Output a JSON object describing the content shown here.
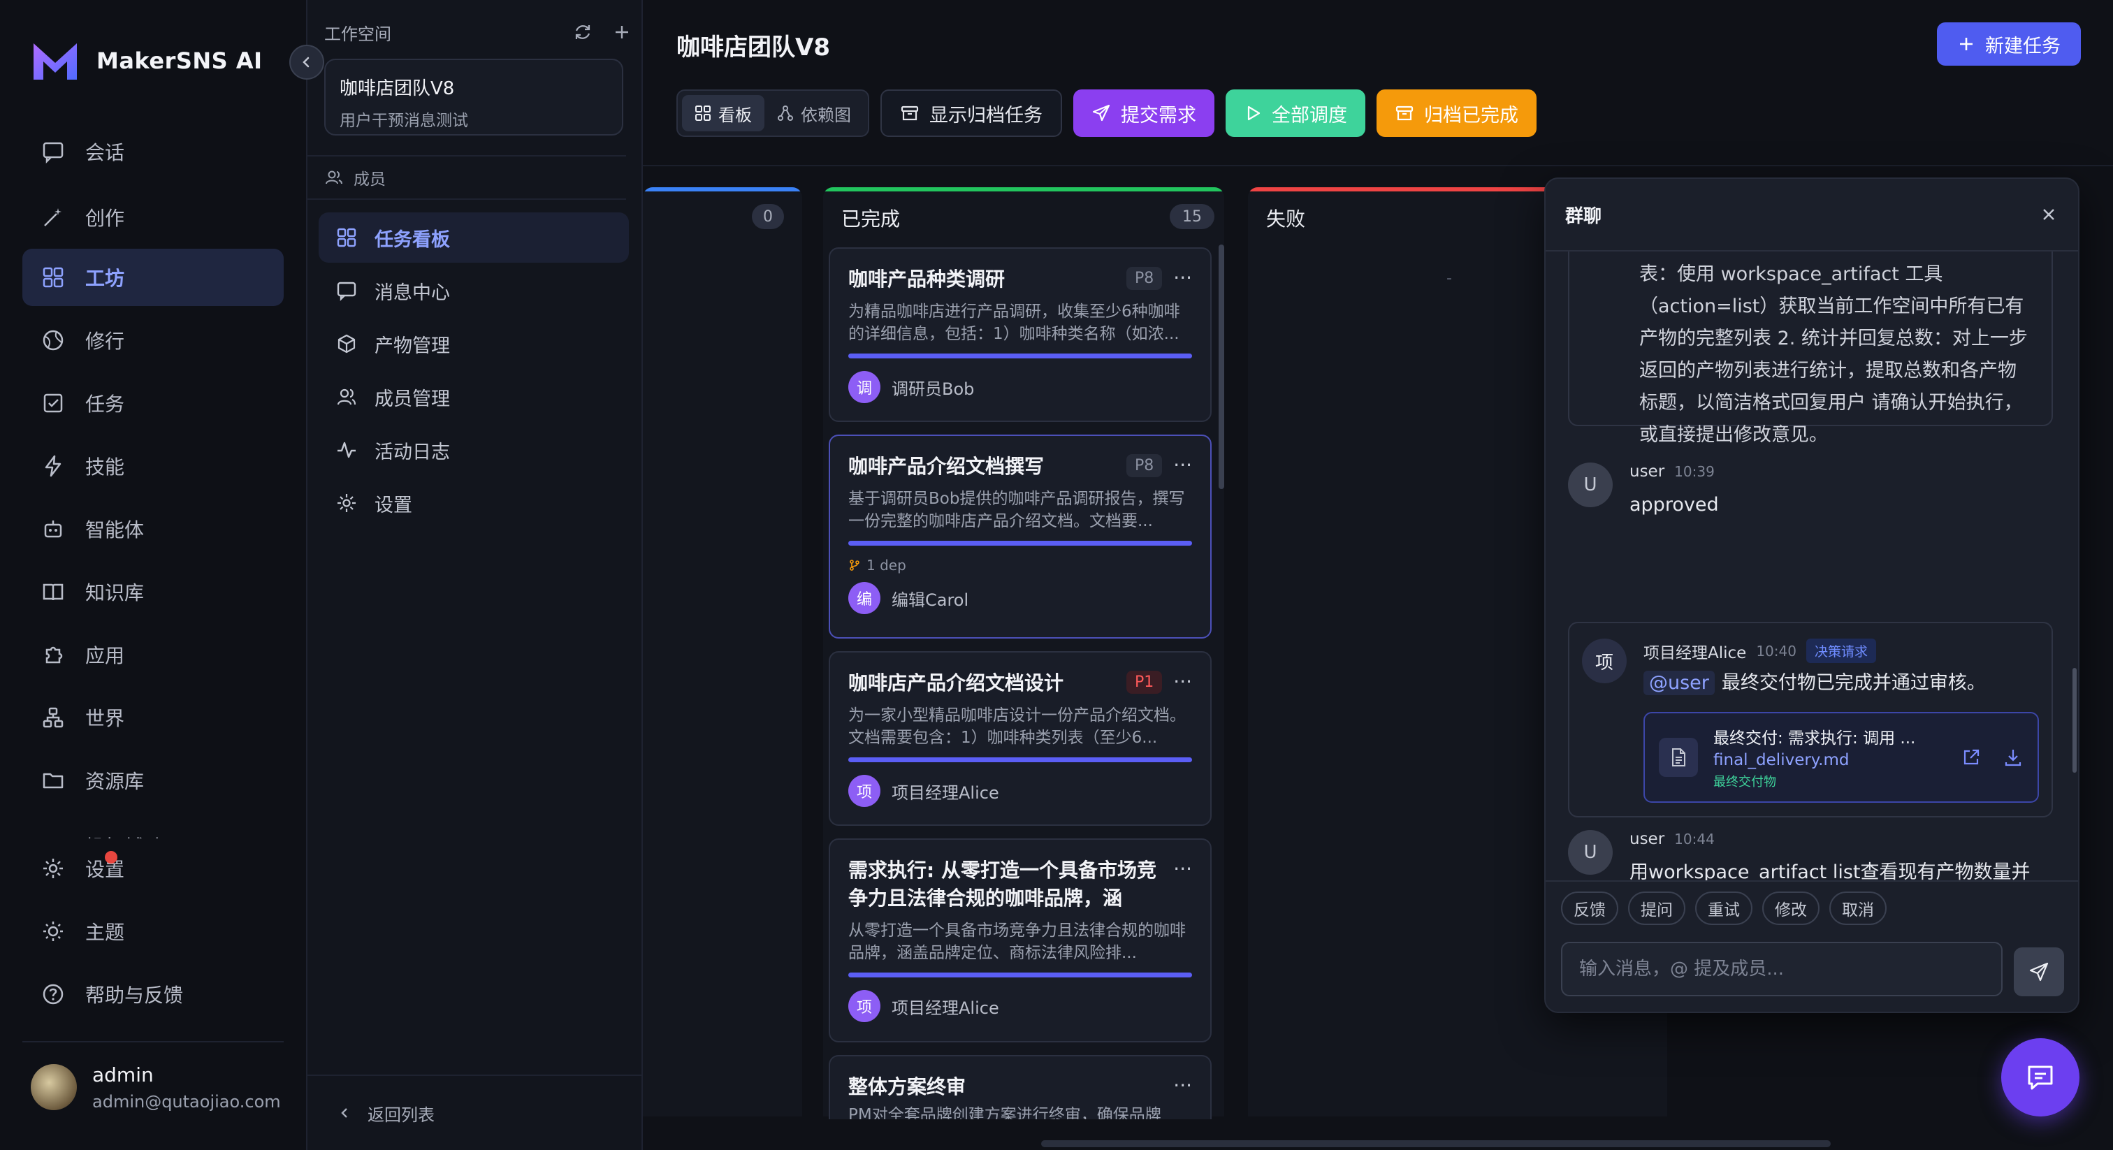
{
  "app": {
    "name": "MakerSNS AI",
    "brand_color": "#6c5cf5"
  },
  "nav": {
    "items": [
      {
        "label": "会话",
        "icon": "chat-bubble-icon"
      },
      {
        "label": "创作",
        "icon": "magic-wand-icon"
      },
      {
        "label": "工坊",
        "icon": "grid-icon",
        "active": true
      },
      {
        "label": "修行",
        "icon": "globe-icon"
      },
      {
        "label": "任务",
        "icon": "checkbox-icon"
      },
      {
        "label": "技能",
        "icon": "lightning-icon"
      },
      {
        "label": "智能体",
        "icon": "robot-icon"
      },
      {
        "label": "知识库",
        "icon": "book-icon"
      },
      {
        "label": "应用",
        "icon": "puzzle-icon"
      },
      {
        "label": "世界",
        "icon": "network-icon"
      },
      {
        "label": "资源库",
        "icon": "folder-icon"
      },
      {
        "label": "投标辅助",
        "icon": "briefcase-icon"
      }
    ],
    "bottom": [
      {
        "label": "设置",
        "icon": "gear-icon"
      },
      {
        "label": "主题",
        "icon": "sun-icon"
      },
      {
        "label": "帮助与反馈",
        "icon": "help-icon"
      }
    ],
    "user": {
      "name": "admin",
      "email": "admin@qutaojiao.com"
    }
  },
  "workspace": {
    "header": "工作空间",
    "name": "咖啡店团队V8",
    "description": "用户干预消息测试",
    "members_label": "成员",
    "menu": [
      {
        "label": "任务看板",
        "icon": "grid-icon",
        "active": true
      },
      {
        "label": "消息中心",
        "icon": "message-icon"
      },
      {
        "label": "产物管理",
        "icon": "cube-icon"
      },
      {
        "label": "成员管理",
        "icon": "users-icon"
      },
      {
        "label": "活动日志",
        "icon": "activity-icon"
      },
      {
        "label": "设置",
        "icon": "gear-icon"
      }
    ],
    "back_label": "返回列表"
  },
  "main": {
    "title": "咖啡店团队V8",
    "new_task_label": "新建任务",
    "view_toggle": {
      "board": "看板",
      "deps": "依赖图"
    },
    "buttons": {
      "show_archived": "显示归档任务",
      "submit": "提交需求",
      "dispatch_all": "全部调度",
      "archive_done": "归档已完成"
    },
    "colors": {
      "accent": "#4f5cf0",
      "purple": "#8b3ff0",
      "green": "#3ed39b",
      "orange": "#f59a0b"
    }
  },
  "board": {
    "columns": [
      {
        "title": "",
        "count": "0",
        "color": "#3b82f6"
      },
      {
        "title": "已完成",
        "count": "15",
        "color": "#22c55e"
      },
      {
        "title": "失败",
        "count": "",
        "color": "#ef4444",
        "empty": "-"
      }
    ],
    "cards": [
      {
        "title": "咖啡产品种类调研",
        "priority": "P8",
        "description": "为精品咖啡店进行产品调研，收集至少6种咖啡的详细信息，包括：1）咖啡种类名称（如浓...",
        "assignee": "调研员Bob",
        "avatar": "调"
      },
      {
        "title": "咖啡产品介绍文档撰写",
        "priority": "P8",
        "description": "基于调研员Bob提供的咖啡产品调研报告，撰写一份完整的咖啡店产品介绍文档。文档要...",
        "dep": "1 dep",
        "assignee": "编辑Carol",
        "avatar": "编"
      },
      {
        "title": "咖啡店产品介绍文档设计",
        "priority": "P1",
        "description": "为一家小型精品咖啡店设计一份产品介绍文档。文档需要包含：1）咖啡种类列表（至少6...",
        "assignee": "项目经理Alice",
        "avatar": "项"
      },
      {
        "title": "需求执行: 从零打造一个具备市场竞争力且法律合规的咖啡品牌，涵盖...",
        "priority": "",
        "description": "从零打造一个具备市场竞争力且法律合规的咖啡品牌，涵盖品牌定位、商标法律风险排...",
        "assignee": "项目经理Alice",
        "avatar": "项"
      },
      {
        "title": "整体方案终审",
        "priority": "",
        "description": "PM对全套品牌创建方案进行终审，确保品牌定...",
        "assignee": "",
        "avatar": ""
      }
    ]
  },
  "chat": {
    "title": "群聊",
    "prev_message": "表：使用 workspace_artifact 工具（action=list）获取当前工作空间中所有已有产物的完整列表 2. 统计并回复总数：对上一步返回的产物列表进行统计，提取总数和各产物标题，以简洁格式回复用户 请确认开始执行，或直接提出修改意见。",
    "messages": [
      {
        "avatar": "U",
        "sender": "user",
        "time": "10:39",
        "text": "approved"
      },
      {
        "avatar": "项",
        "sender": "项目经理Alice",
        "time": "10:40",
        "badge": "决策请求",
        "mention": "@user",
        "text": "最终交付物已完成并通过审核。",
        "file": {
          "title": "最终交付: 需求执行: 调用 ...",
          "filename": "final_delivery.md",
          "tag": "最终交付物"
        }
      },
      {
        "avatar": "U",
        "sender": "user",
        "time": "10:44",
        "text": "用workspace_artifact list查看现有产物数量并回复"
      }
    ],
    "quick_actions": [
      "反馈",
      "提问",
      "重试",
      "修改",
      "取消"
    ],
    "input_placeholder": "输入消息，@ 提及成员..."
  }
}
